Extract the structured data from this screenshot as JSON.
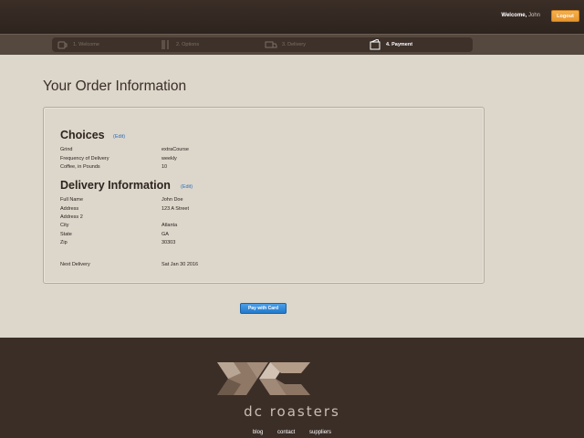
{
  "header": {
    "welcome_prefix": "Welcome,",
    "username": "John",
    "logout_label": "Logout"
  },
  "steps": [
    {
      "label": "1. Welcome",
      "icon": "coffee-cup-icon",
      "active": false
    },
    {
      "label": "2. Options",
      "icon": "utensils-icon",
      "active": false
    },
    {
      "label": "3. Delivery",
      "icon": "truck-icon",
      "active": false
    },
    {
      "label": "4. Payment",
      "icon": "wallet-icon",
      "active": true
    }
  ],
  "main": {
    "title": "Your Order Information",
    "choices": {
      "heading": "Choices",
      "edit_label": "(Edit)",
      "rows": [
        {
          "label": "Grind",
          "value": "extraCourse"
        },
        {
          "label": "Frequency of Delivery",
          "value": "weekly"
        },
        {
          "label": "Coffee, in Pounds",
          "value": "10"
        }
      ]
    },
    "delivery": {
      "heading": "Delivery Information",
      "edit_label": "(Edit)",
      "rows": [
        {
          "label": "Full Name",
          "value": "John Doe"
        },
        {
          "label": "Address",
          "value": "123 A Street"
        },
        {
          "label": "Address 2",
          "value": ""
        },
        {
          "label": "City",
          "value": "Atlanta"
        },
        {
          "label": "State",
          "value": "GA"
        },
        {
          "label": "Zip",
          "value": "30303"
        }
      ]
    },
    "next_delivery": {
      "label": "Next Delivery",
      "value": "Sat Jan 30 2016"
    },
    "pay_label": "Pay with Card"
  },
  "footer": {
    "brand": "dc roasters",
    "links": [
      "blog",
      "contact",
      "suppliers"
    ]
  },
  "colors": {
    "accent_orange": "#f0a23e",
    "link_blue": "#2e6fb7",
    "pay_blue": "#2f86d6",
    "dark_brown": "#3b2e27",
    "background": "#dcd6cb"
  }
}
